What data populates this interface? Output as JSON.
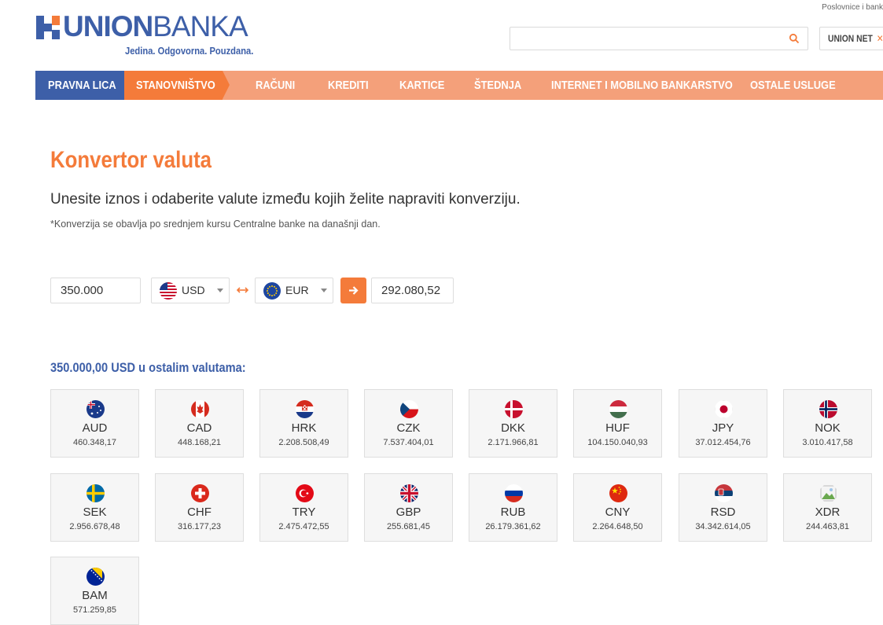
{
  "header": {
    "logo_union": "UNION",
    "logo_banka": "BANKA",
    "tagline": "Jedina. Odgovorna. Pouzdana.",
    "top_link": "Poslovnice i bank",
    "union_net_label": "UNION NET",
    "union_net_icon": "close-icon"
  },
  "nav": {
    "pravna": "PRAVNA LICA",
    "stanovnistvo": "STANOVNIŠTVO",
    "items": [
      "RAČUNI",
      "KREDITI",
      "KARTICE",
      "ŠTEDNJA",
      "INTERNET I MOBILNO BANKARSTVO",
      "OSTALE USLUGE"
    ]
  },
  "main": {
    "title": "Konvertor valuta",
    "subtitle": "Unesite iznos i odaberite valute između kojih želite napraviti konverziju.",
    "note": "*Konverzija se obavlja po srednjem kursu Centralne banke na današnji dan.",
    "amount": "350.000",
    "from_currency": "USD",
    "to_currency": "EUR",
    "result": "292.080,52",
    "others_title": "350.000,00 USD u ostalim valutama:"
  },
  "rates": [
    {
      "code": "AUD",
      "value": "460.348,17"
    },
    {
      "code": "CAD",
      "value": "448.168,21"
    },
    {
      "code": "HRK",
      "value": "2.208.508,49"
    },
    {
      "code": "CZK",
      "value": "7.537.404,01"
    },
    {
      "code": "DKK",
      "value": "2.171.966,81"
    },
    {
      "code": "HUF",
      "value": "104.150.040,93"
    },
    {
      "code": "JPY",
      "value": "37.012.454,76"
    },
    {
      "code": "NOK",
      "value": "3.010.417,58"
    },
    {
      "code": "SEK",
      "value": "2.956.678,48"
    },
    {
      "code": "CHF",
      "value": "316.177,23"
    },
    {
      "code": "TRY",
      "value": "2.475.472,55"
    },
    {
      "code": "GBP",
      "value": "255.681,45"
    },
    {
      "code": "RUB",
      "value": "26.179.361,62"
    },
    {
      "code": "CNY",
      "value": "2.264.648,50"
    },
    {
      "code": "RSD",
      "value": "34.342.614,05"
    },
    {
      "code": "XDR",
      "value": "244.463,81"
    },
    {
      "code": "BAM",
      "value": "571.259,85"
    }
  ],
  "colors": {
    "brand_blue": "#3d5fa8",
    "brand_orange": "#f47b3a",
    "nav_light_orange": "#f4a07a"
  }
}
